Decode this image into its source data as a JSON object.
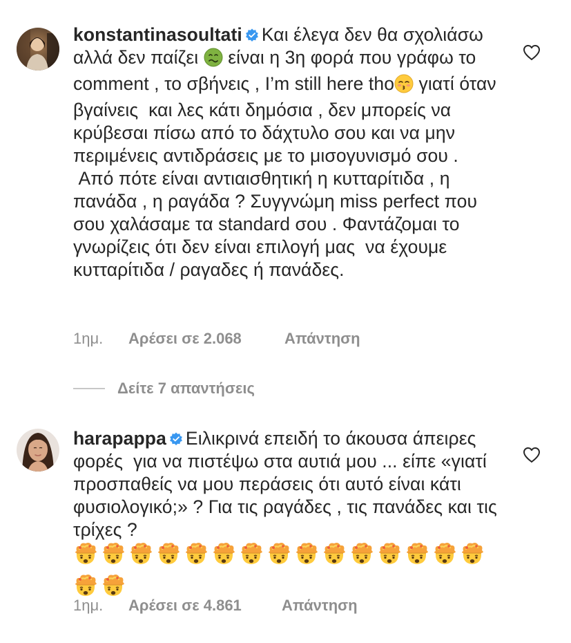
{
  "comments": [
    {
      "username": "konstantinasoultati",
      "verified": true,
      "text_segments": [
        "Και έλεγα δεν θα σχολιάσω αλλά δεν παίζει ",
        " είναι η 3η φορά που γράφω το comment , το σβήνεις , I’m still here tho",
        " γιατί όταν βγαίνεις  και λες κάτι δημόσια , δεν μπορείς να κρύβεσαι πίσω από το δάχτυλο σου και να μην περιμένεις αντιδράσεις με το μισογυνισμό σου .\n Από πότε είναι αντιαισθητική η κυτταρίτιδα , η πανάδα , η ραγάδα ? Συγγνώμη miss perfect που σου χαλάσαμε τα standard σου . Φαντάζομαι το γνωρίζεις ότι δεν είναι επιλογή μας  να έχουμε κυτταρίτιδα / ραγαδες ή πανάδες."
      ],
      "emojis": [
        "nauseated-face-emoji",
        "kissing-face-emoji"
      ],
      "time": "1ημ.",
      "likes": "Αρέσει σε 2.068",
      "reply": "Απάντηση"
    },
    {
      "username": "harapappa",
      "verified": true,
      "text": "Ειλικρινά επειδή το άκουσα άπειρες φορές  για να πιστέψω στα αυτιά μου ... είπε «γιατί προσπαθείς να μου περάσεις ότι αυτό είναι κάτι φυσιολογικό;» ? Για τις ραγάδες , τις πανάδες και τις τρίχες ?",
      "emoji_name": "exploding-head-emoji",
      "emoji_count": 17,
      "time": "1ημ.",
      "likes": "Αρέσει σε 4.861",
      "reply": "Απάντηση"
    }
  ],
  "view_replies": "Δείτε 7 απαντήσεις",
  "colors": {
    "text": "#262626",
    "secondary": "#8e8e8e",
    "verified": "#3897f0",
    "divider": "#c7c7c7"
  },
  "icons": [
    "heart-outline-icon",
    "verified-badge-icon"
  ]
}
